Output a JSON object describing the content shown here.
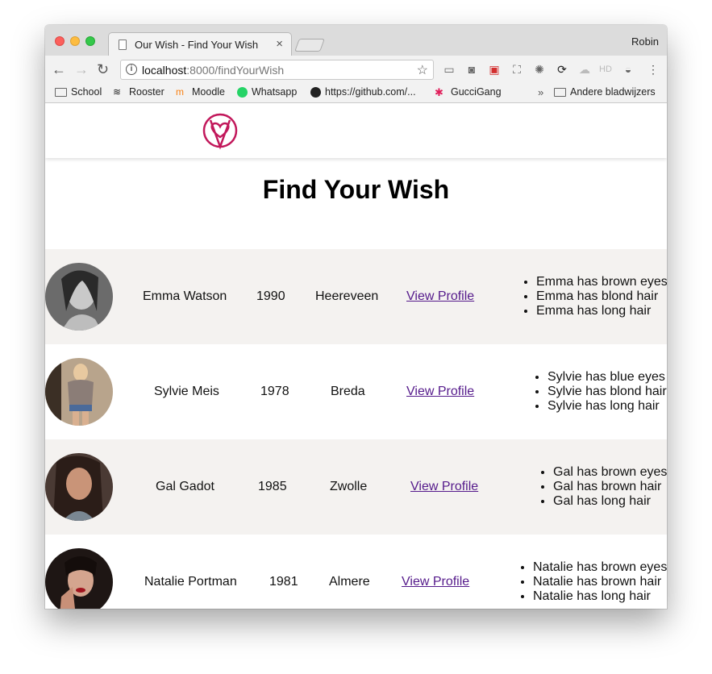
{
  "browser": {
    "tab_title": "Our Wish - Find Your Wish",
    "tab_close": "×",
    "profile_name": "Robin",
    "url_host": "localhost",
    "url_rest": ":8000/findYourWish",
    "nav": {
      "back": "←",
      "forward": "→",
      "reload": "↻"
    },
    "bookmarks": [
      {
        "label": "School",
        "icon": "folder-icon"
      },
      {
        "label": "Rooster",
        "icon": "wifi-icon"
      },
      {
        "label": "Moodle",
        "icon": "moodle-icon"
      },
      {
        "label": "Whatsapp",
        "icon": "whatsapp-icon"
      },
      {
        "label": "https://github.com/...",
        "icon": "github-icon"
      },
      {
        "label": "GucciGang",
        "icon": "slack-icon"
      }
    ],
    "bookmarks_more": "»",
    "other_bookmarks": "Andere bladwijzers",
    "colors": {
      "accent": "#c2185b",
      "link": "#551a8b"
    }
  },
  "page": {
    "title": "Find Your Wish",
    "logo_icon": "heart-logo-icon",
    "link_label": "View Profile",
    "people": [
      {
        "name": "Emma Watson",
        "year": "1990",
        "city": "Heereveen",
        "traits": [
          "Emma has brown eyes",
          "Emma has blond hair",
          "Emma has long hair"
        ]
      },
      {
        "name": "Sylvie Meis",
        "year": "1978",
        "city": "Breda",
        "traits": [
          "Sylvie has blue eyes",
          "Sylvie has blond hair",
          "Sylvie has long hair"
        ]
      },
      {
        "name": "Gal Gadot",
        "year": "1985",
        "city": "Zwolle",
        "traits": [
          "Gal has brown eyes",
          "Gal has brown hair",
          "Gal has long hair"
        ]
      },
      {
        "name": "Natalie Portman",
        "year": "1981",
        "city": "Almere",
        "traits": [
          "Natalie has brown eyes",
          "Natalie has brown hair",
          "Natalie has long hair"
        ]
      }
    ]
  }
}
